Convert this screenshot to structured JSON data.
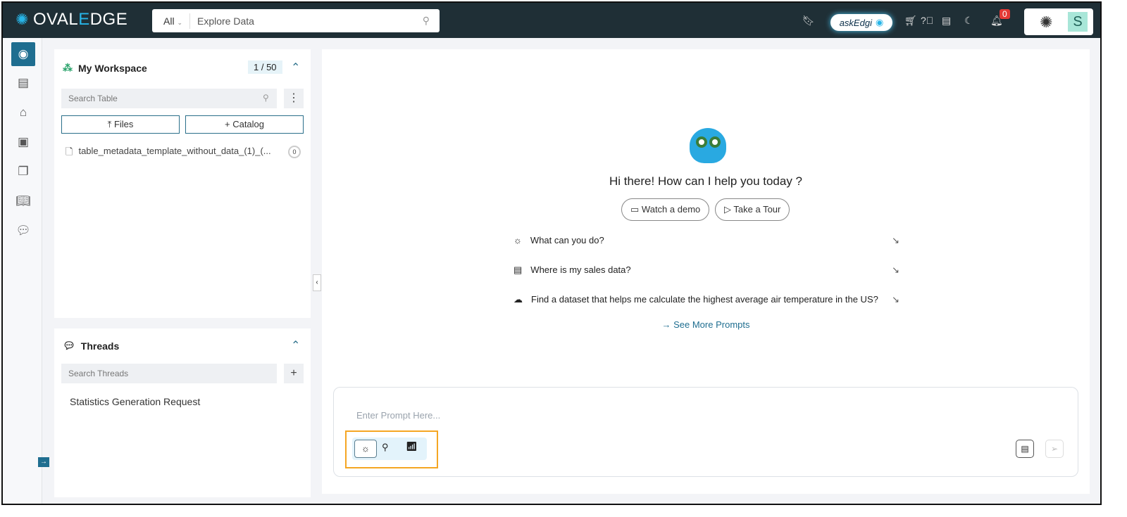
{
  "header": {
    "logo_pre": "OVAL",
    "logo_e": "E",
    "logo_post": "DGE",
    "search_scope": "All",
    "search_placeholder": "Explore Data",
    "askedgi": "askEdgi",
    "notification_count": "0",
    "user_initial": "S"
  },
  "workspace": {
    "title": "My Workspace",
    "count": "1 / 50",
    "search_placeholder": "Search Table",
    "files_label": "Files",
    "catalog_label": "Catalog",
    "items": [
      {
        "name": "table_metadata_template_without_data_(1)_(...",
        "badge": "0"
      }
    ]
  },
  "threads": {
    "title": "Threads",
    "search_placeholder": "Search Threads",
    "items": [
      "Statistics Generation Request"
    ]
  },
  "main": {
    "greeting": "Hi there! How can I help you today ?",
    "watch_demo": "Watch a demo",
    "take_tour": "Take a Tour",
    "prompts": [
      "What can you do?",
      "Where is my sales data?",
      "Find a dataset that helps me calculate the highest average air temperature in the US?"
    ],
    "see_more": "→ See More Prompts",
    "input_placeholder": "Enter Prompt Here..."
  },
  "colors": {
    "header": "#1f2f36",
    "accent": "#1f6e90",
    "highlight": "#f5a623",
    "badge": "#e53935"
  }
}
